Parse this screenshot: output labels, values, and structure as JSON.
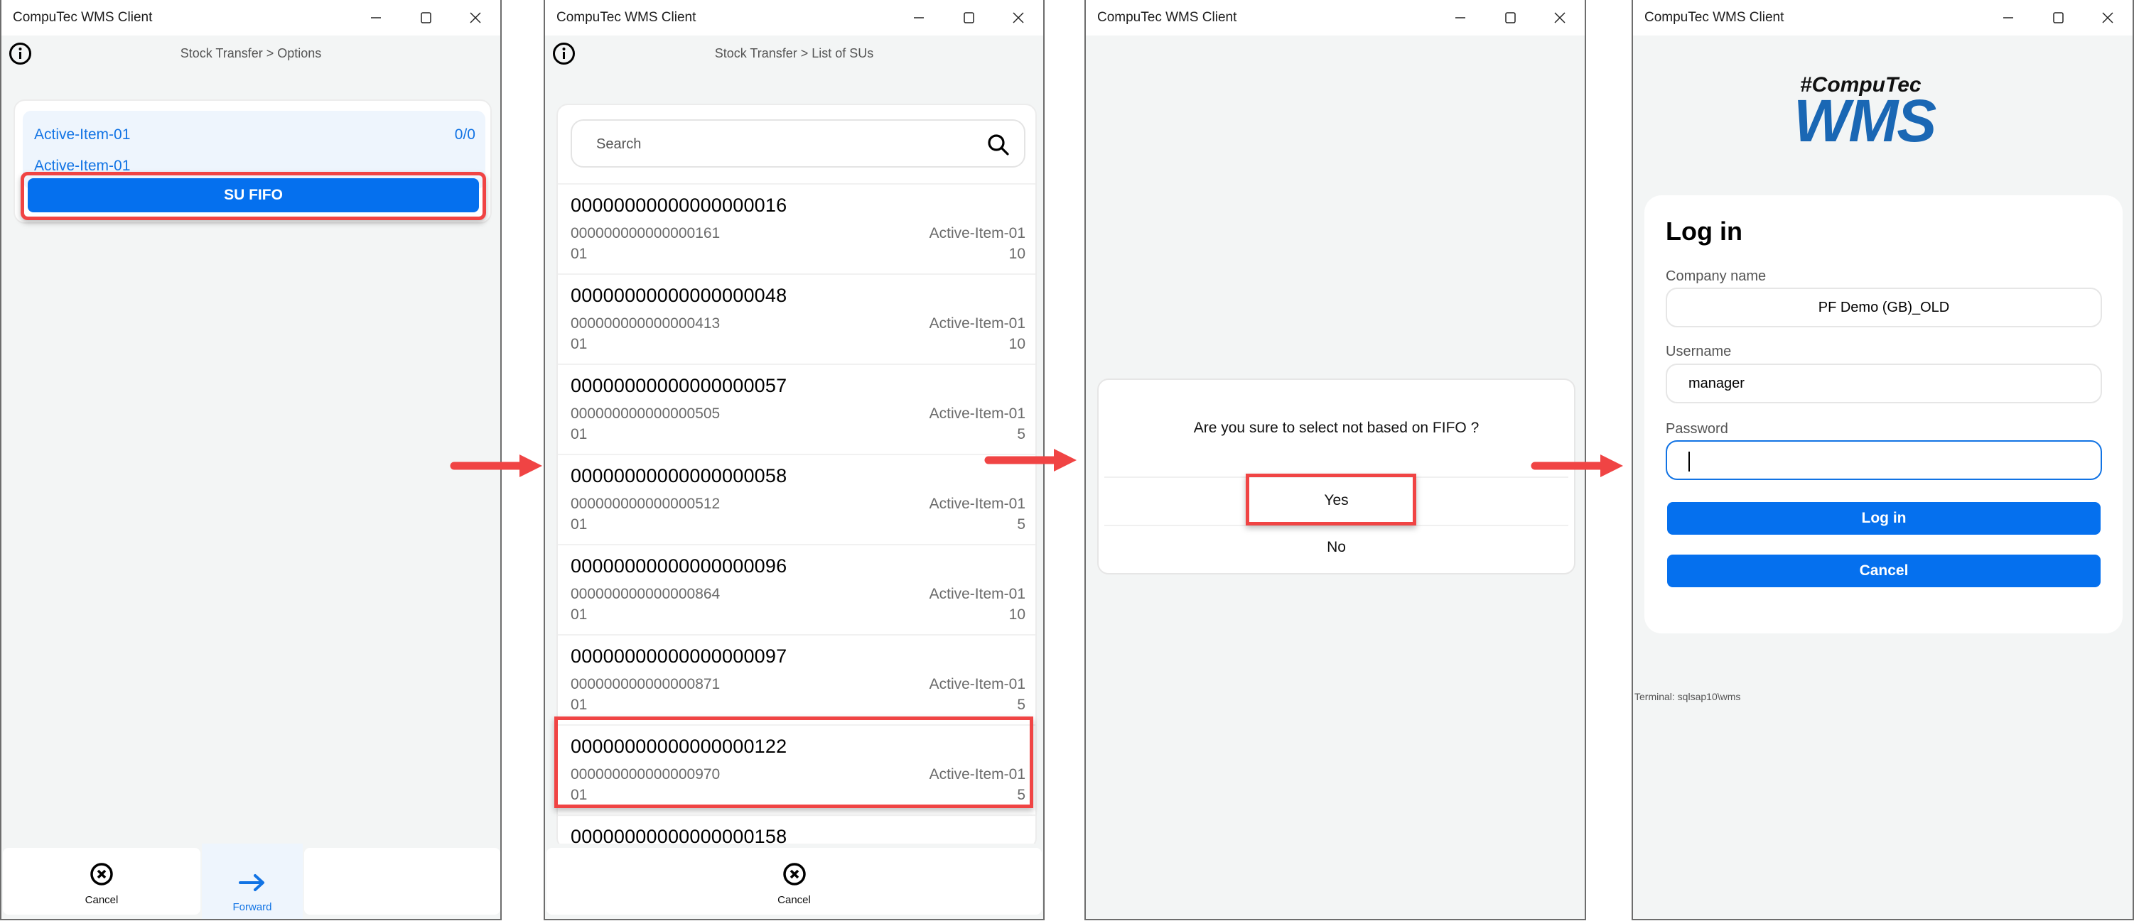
{
  "app_title": "CompuTec WMS Client",
  "colors": {
    "accent": "#0570ee",
    "accent_text": "#1173e4",
    "highlight": "#f04444",
    "background": "#f3f5f5",
    "logo_blue": "#1a67b4"
  },
  "window_controls": {
    "minimize": "minimize-icon",
    "maximize": "maximize-icon",
    "close": "close-icon"
  },
  "panel1": {
    "breadcrumb": "Stock Transfer > Options",
    "item_line1": "Active-Item-01",
    "item_line2": "Active-Item-01",
    "quantity": "0/0",
    "su_fifo_label": "SU FIFO",
    "bottom_nav": [
      {
        "label": "Cancel",
        "icon": "cancel-circle-icon"
      },
      {
        "label": "Forward",
        "icon": "arrow-right-icon"
      }
    ]
  },
  "panel2": {
    "breadcrumb": "Stock Transfer > List of SUs",
    "search_placeholder": "Search",
    "rows": [
      {
        "code": "00000000000000000016",
        "sub": "000000000000000161",
        "warehouse": "01",
        "item": "Active-Item-01",
        "qty": "10"
      },
      {
        "code": "00000000000000000048",
        "sub": "000000000000000413",
        "warehouse": "01",
        "item": "Active-Item-01",
        "qty": "10"
      },
      {
        "code": "00000000000000000057",
        "sub": "000000000000000505",
        "warehouse": "01",
        "item": "Active-Item-01",
        "qty": "5"
      },
      {
        "code": "00000000000000000058",
        "sub": "000000000000000512",
        "warehouse": "01",
        "item": "Active-Item-01",
        "qty": "5"
      },
      {
        "code": "00000000000000000096",
        "sub": "000000000000000864",
        "warehouse": "01",
        "item": "Active-Item-01",
        "qty": "10"
      },
      {
        "code": "00000000000000000097",
        "sub": "000000000000000871",
        "warehouse": "01",
        "item": "Active-Item-01",
        "qty": "5"
      },
      {
        "code": "00000000000000000122",
        "sub": "000000000000000970",
        "warehouse": "01",
        "item": "Active-Item-01",
        "qty": "5"
      },
      {
        "code": "00000000000000000158",
        "sub": "",
        "warehouse": "",
        "item": "",
        "qty": ""
      }
    ],
    "highlighted_row": "00000000000000000122",
    "bottom_nav": [
      {
        "label": "Cancel",
        "icon": "cancel-circle-icon"
      }
    ]
  },
  "panel3": {
    "dialog_message": "Are you sure to select not based on FIFO ?",
    "yes_label": "Yes",
    "no_label": "No"
  },
  "panel4": {
    "logo_top": "#CompuTec",
    "logo_main": "WMS",
    "login_title": "Log in",
    "company_label": "Company name",
    "company_value": "PF Demo (GB)_OLD",
    "username_label": "Username",
    "username_value": "manager",
    "password_label": "Password",
    "password_value": "",
    "login_button": "Log in",
    "cancel_button": "Cancel",
    "terminal": "Terminal: sqlsap10\\wms"
  }
}
